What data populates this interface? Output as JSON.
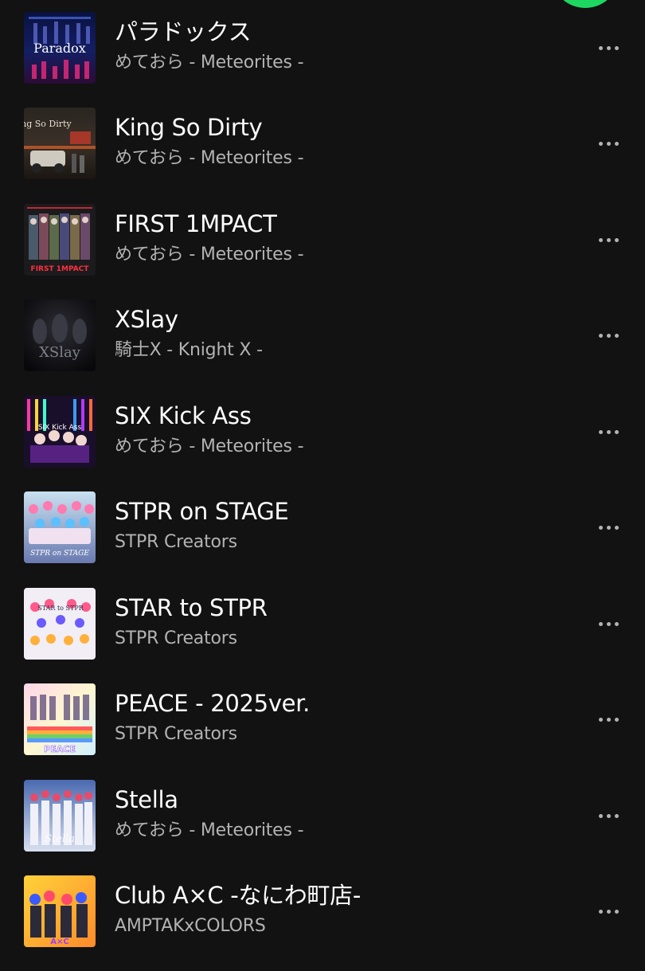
{
  "colors": {
    "background": "#121212",
    "title": "#ffffff",
    "subtitle": "#b3b3b3",
    "accent_play_button": "#1ed760"
  },
  "tracks": [
    {
      "title": "パラドックス",
      "artist": "めておら - Meteorites -",
      "cover_text": "Paradox",
      "cover_icon": "album-art"
    },
    {
      "title": "King So Dirty",
      "artist": "めておら - Meteorites -",
      "cover_text": "King So Dirty",
      "cover_icon": "album-art"
    },
    {
      "title": "FIRST 1MPACT",
      "artist": "めておら - Meteorites -",
      "cover_text": "FIRST 1MPACT",
      "cover_icon": "album-art"
    },
    {
      "title": "XSlay",
      "artist": "騎士X - Knight X -",
      "cover_text": "XSlay",
      "cover_icon": "album-art"
    },
    {
      "title": "SIX Kick Ass",
      "artist": "めておら - Meteorites -",
      "cover_text": "SIX Kick Ass",
      "cover_icon": "album-art"
    },
    {
      "title": "STPR on STAGE",
      "artist": "STPR Creators",
      "cover_text": "STPR on STAGE",
      "cover_icon": "album-art"
    },
    {
      "title": "STAR to STPR",
      "artist": "STPR Creators",
      "cover_text": "STAR to STPR",
      "cover_icon": "album-art"
    },
    {
      "title": "PEACE - 2025ver.",
      "artist": "STPR Creators",
      "cover_text": "PEACE",
      "cover_icon": "album-art"
    },
    {
      "title": "Stella",
      "artist": "めておら - Meteorites -",
      "cover_text": "Stella",
      "cover_icon": "album-art"
    },
    {
      "title": "Club A×C -なにわ町店-",
      "artist": "AMPTAKxCOLORS",
      "cover_text": "A×C",
      "cover_icon": "album-art"
    }
  ],
  "icons": {
    "more": "more-options-icon",
    "play": "play-button"
  }
}
